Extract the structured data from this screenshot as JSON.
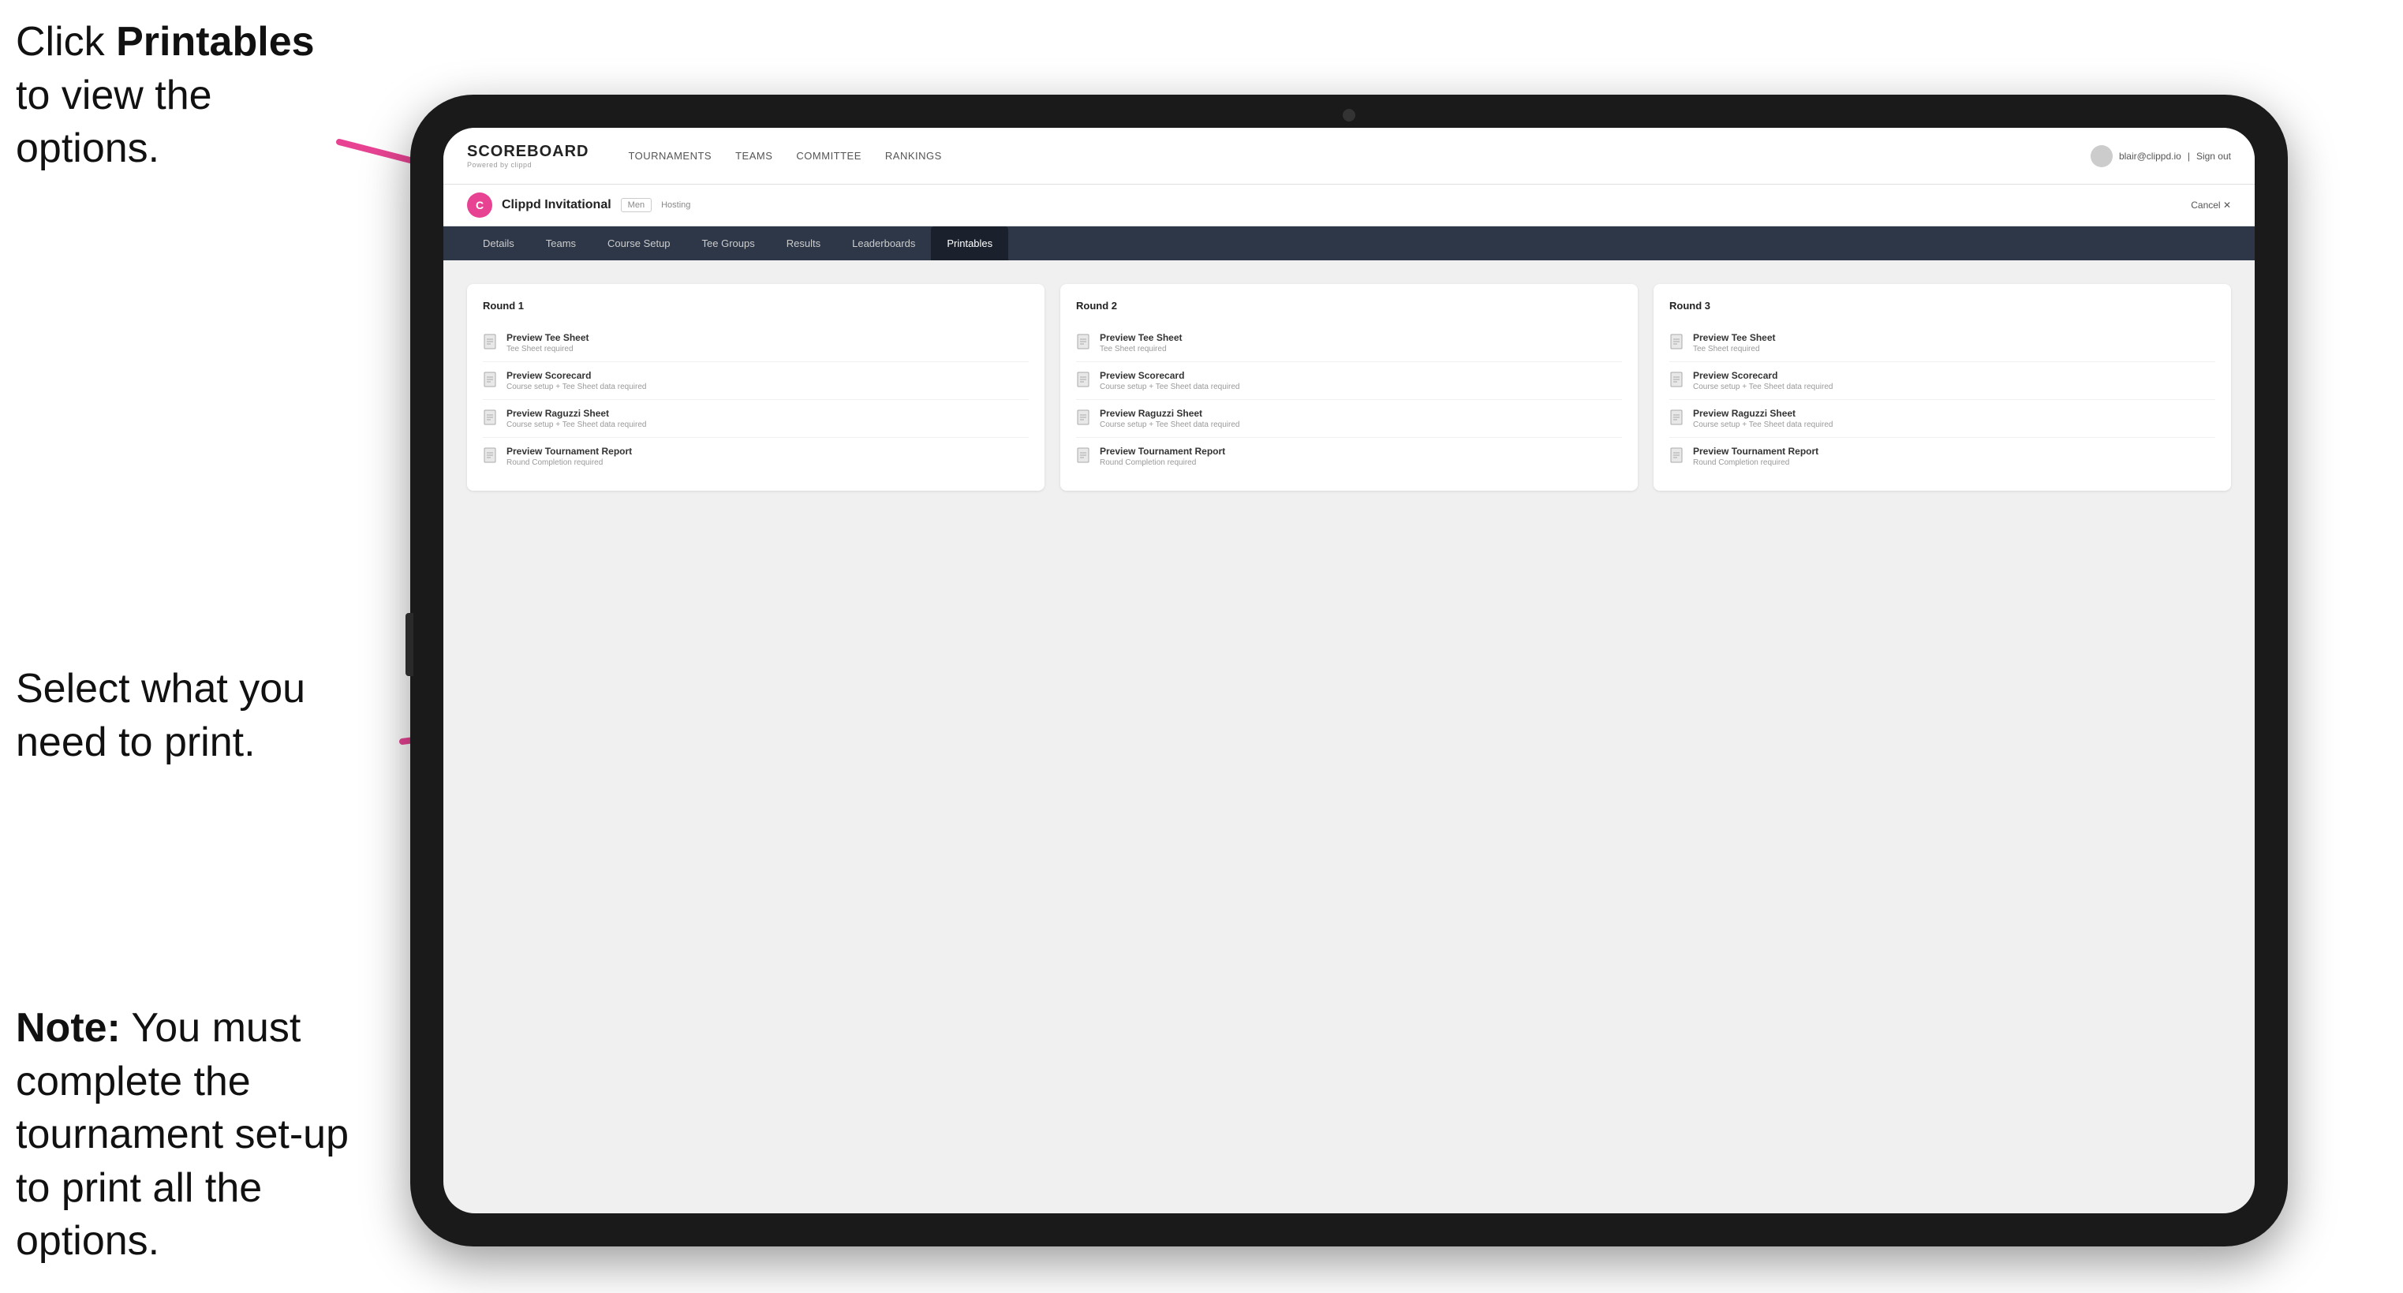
{
  "annotations": {
    "top": {
      "text_prefix": "Click ",
      "text_bold": "Printables",
      "text_suffix": " to view the options."
    },
    "middle": {
      "text": "Select what you need to print."
    },
    "bottom": {
      "text_bold": "Note:",
      "text_suffix": " You must complete the tournament set-up to print all the options."
    }
  },
  "nav": {
    "logo": "SCOREBOARD",
    "logo_sub": "Powered by clippd",
    "links": [
      {
        "label": "TOURNAMENTS",
        "active": false
      },
      {
        "label": "TEAMS",
        "active": false
      },
      {
        "label": "COMMITTEE",
        "active": false
      },
      {
        "label": "RANKINGS",
        "active": false
      }
    ],
    "user_email": "blair@clippd.io",
    "sign_out": "Sign out"
  },
  "tournament": {
    "logo_letter": "C",
    "name": "Clippd Invitational",
    "badge": "Men",
    "status": "Hosting",
    "cancel": "Cancel"
  },
  "sub_nav": {
    "items": [
      {
        "label": "Details",
        "active": false
      },
      {
        "label": "Teams",
        "active": false
      },
      {
        "label": "Course Setup",
        "active": false
      },
      {
        "label": "Tee Groups",
        "active": false
      },
      {
        "label": "Results",
        "active": false
      },
      {
        "label": "Leaderboards",
        "active": false
      },
      {
        "label": "Printables",
        "active": true
      }
    ]
  },
  "rounds": [
    {
      "title": "Round 1",
      "items": [
        {
          "title": "Preview Tee Sheet",
          "subtitle": "Tee Sheet required"
        },
        {
          "title": "Preview Scorecard",
          "subtitle": "Course setup + Tee Sheet data required"
        },
        {
          "title": "Preview Raguzzi Sheet",
          "subtitle": "Course setup + Tee Sheet data required"
        },
        {
          "title": "Preview Tournament Report",
          "subtitle": "Round Completion required"
        }
      ]
    },
    {
      "title": "Round 2",
      "items": [
        {
          "title": "Preview Tee Sheet",
          "subtitle": "Tee Sheet required"
        },
        {
          "title": "Preview Scorecard",
          "subtitle": "Course setup + Tee Sheet data required"
        },
        {
          "title": "Preview Raguzzi Sheet",
          "subtitle": "Course setup + Tee Sheet data required"
        },
        {
          "title": "Preview Tournament Report",
          "subtitle": "Round Completion required"
        }
      ]
    },
    {
      "title": "Round 3",
      "items": [
        {
          "title": "Preview Tee Sheet",
          "subtitle": "Tee Sheet required"
        },
        {
          "title": "Preview Scorecard",
          "subtitle": "Course setup + Tee Sheet data required"
        },
        {
          "title": "Preview Raguzzi Sheet",
          "subtitle": "Course setup + Tee Sheet data required"
        },
        {
          "title": "Preview Tournament Report",
          "subtitle": "Round Completion required"
        }
      ]
    }
  ]
}
